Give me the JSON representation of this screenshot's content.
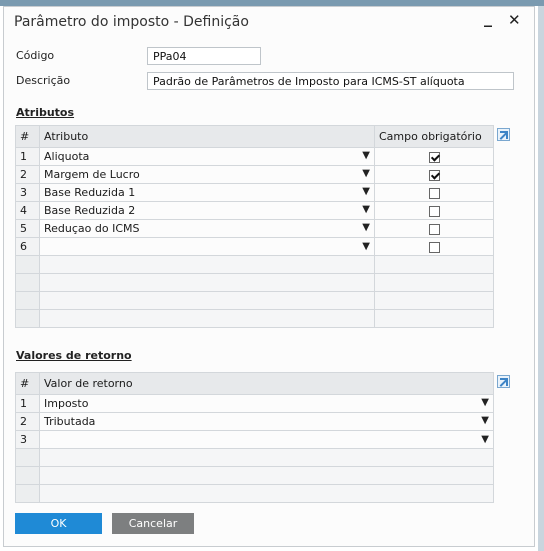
{
  "window": {
    "title": "Parâmetro do imposto - Definição",
    "minimize_glyph": "_",
    "close_glyph": "✕"
  },
  "form": {
    "codigo_label": "Código",
    "codigo_value": "PPa04",
    "descricao_label": "Descrição",
    "descricao_value": "Padrão de Parâmetros de Imposto para ICMS-ST alíquota"
  },
  "atributos": {
    "section_label": "Atributos",
    "headers": {
      "num": "#",
      "atributo": "Atributo",
      "campo": "Campo obrigatório"
    },
    "rows": [
      {
        "num": "1",
        "atributo": "Aliquota",
        "obrigatorio": true
      },
      {
        "num": "2",
        "atributo": "Margem de Lucro",
        "obrigatorio": true
      },
      {
        "num": "3",
        "atributo": "Base Reduzida 1",
        "obrigatorio": false
      },
      {
        "num": "4",
        "atributo": "Base Reduzida 2",
        "obrigatorio": false
      },
      {
        "num": "5",
        "atributo": "Reduçao do ICMS",
        "obrigatorio": false
      },
      {
        "num": "6",
        "atributo": "",
        "obrigatorio": false
      }
    ],
    "expand_icon": "expand-arrow-icon"
  },
  "valores": {
    "section_label": "Valores de retorno",
    "headers": {
      "num": "#",
      "valor": "Valor de retorno"
    },
    "rows": [
      {
        "num": "1",
        "valor": "Imposto"
      },
      {
        "num": "2",
        "valor": "Tributada"
      },
      {
        "num": "3",
        "valor": ""
      }
    ],
    "expand_icon": "expand-arrow-icon"
  },
  "buttons": {
    "ok": "OK",
    "cancel": "Cancelar"
  },
  "colors": {
    "ok_button": "#1f8ad6",
    "cancel_button": "#7d7f80",
    "expand_icon": "#3d84c6"
  }
}
